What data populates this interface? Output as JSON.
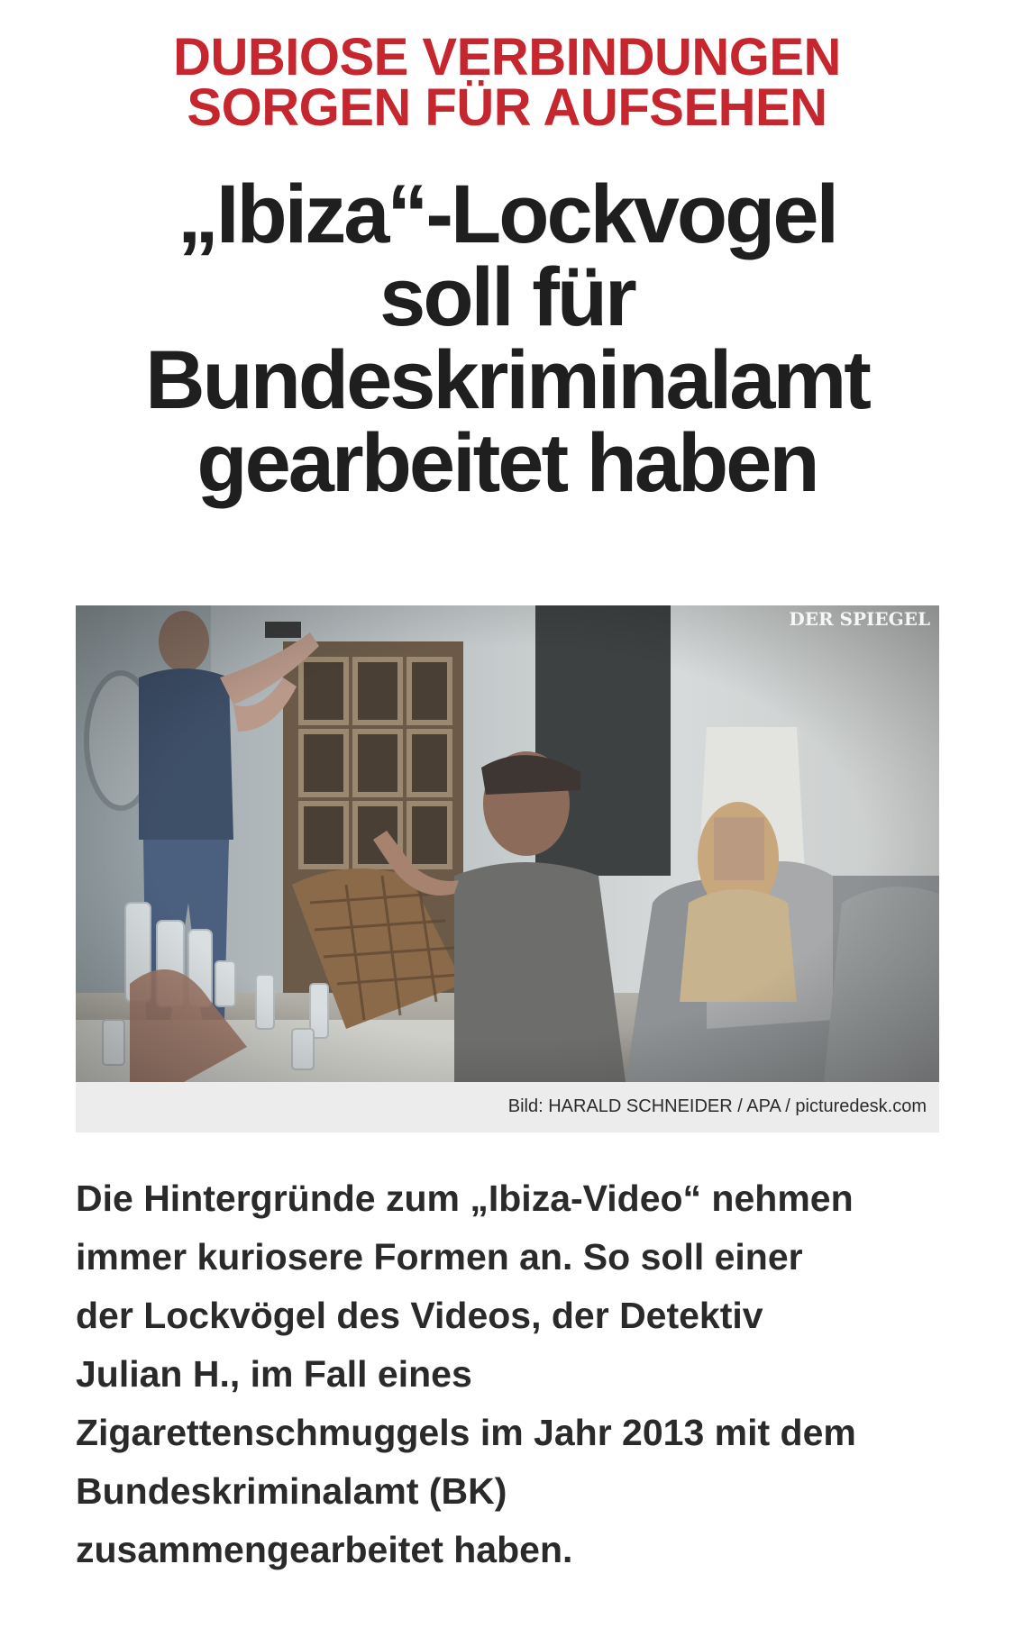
{
  "article": {
    "kicker": [
      "DUBIOSE VERBINDUNGEN",
      "SORGEN FÜR AUFSEHEN"
    ],
    "headline": [
      "„Ibiza“-Lockvogel",
      "soll für",
      "Bundeskriminalamt",
      "gearbeitet haben"
    ],
    "image": {
      "watermark": "DER SPIEGEL",
      "caption": "Bild: HARALD SCHNEIDER / APA / picturedesk.com"
    },
    "lead": [
      "Die Hintergründe zum „Ibiza-Video“ nehmen",
      "immer kuriosere Formen an. So soll einer",
      "der Lockvögel des Videos, der Detektiv",
      "Julian H., im Fall eines",
      "Zigarettenschmuggels im Jahr 2013 mit dem",
      "Bundeskriminalamt (BK)",
      "zusammengearbeitet haben."
    ]
  },
  "colors": {
    "kicker": "#c6262e",
    "headline": "#1f1f1f",
    "body": "#2a2a2a",
    "caption_bg": "#ececec"
  }
}
